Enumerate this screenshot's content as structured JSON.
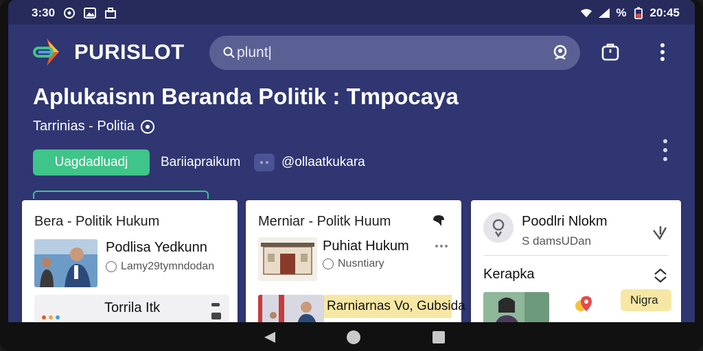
{
  "status_bar": {
    "time_left": "3:30",
    "time_right": "20:45",
    "battery_text": "%"
  },
  "app": {
    "brand": "PURISLOT",
    "search": {
      "value": "plunt|"
    },
    "colors": {
      "primary": "#2f3672",
      "accent": "#3fc48a",
      "searchbar": "#5a6093"
    }
  },
  "hero": {
    "title": "Aplukaisnn Beranda Politik : Tmpocaya",
    "subtitle": "Tarrinias - Politia",
    "cta_label": "Uagdadluadj",
    "link_label": "Bariiapraikum",
    "handle": "@ollaatkukara"
  },
  "cards": {
    "card1": {
      "title": "Bera - Politik Hukum",
      "item1": {
        "title": "Podlisa Yedkunn",
        "meta": "Lamy29tymndodan"
      },
      "item2": {
        "title": "Torrila Itk"
      }
    },
    "card2": {
      "title": "Merniar - Politk Huum",
      "item1": {
        "title": "Puhiat Hukum",
        "meta": "Nusntiary"
      },
      "item2": {
        "title": "Rarniarnas Vo, Gubsida"
      }
    },
    "card3": {
      "header_title": "Poodlri Nlokm",
      "header_sub": "S damsUDan",
      "section_title": "Kerapka",
      "badge": "Nigra"
    }
  }
}
